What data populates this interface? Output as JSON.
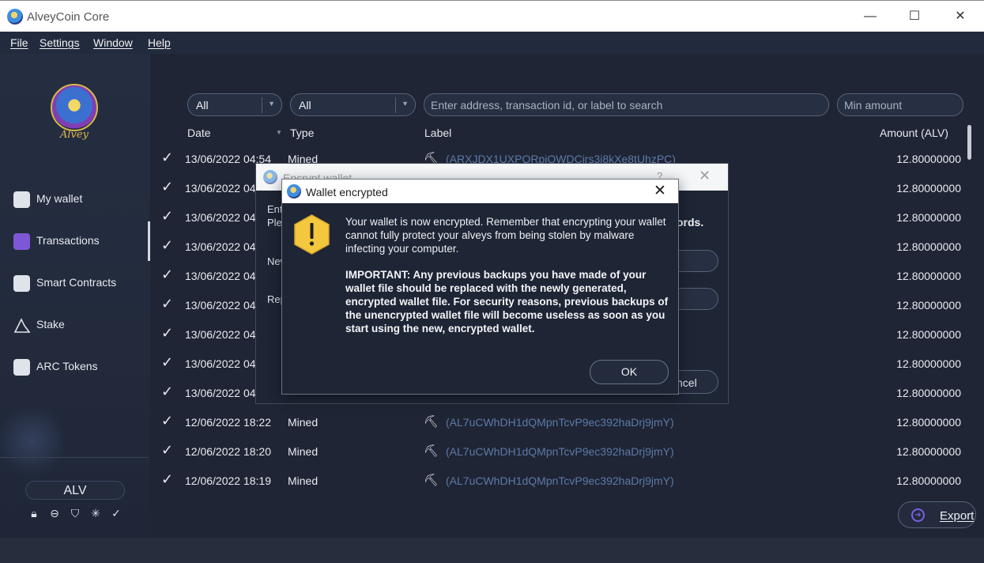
{
  "window": {
    "title": "AlveyCoin Core",
    "minimize_glyph": "—",
    "maximize_glyph": "☐",
    "close_glyph": "✕"
  },
  "menu": [
    "File",
    "Settings",
    "Window",
    "Help"
  ],
  "sidebar": {
    "avatar_caption": "Alvey",
    "items": [
      {
        "label": "My wallet",
        "icon": "wallet-icon"
      },
      {
        "label": "Transactions",
        "icon": "transactions-icon",
        "active": true
      },
      {
        "label": "Smart Contracts",
        "icon": "smart-contracts-icon"
      },
      {
        "label": "Stake",
        "icon": "stake-icon"
      },
      {
        "label": "ARC Tokens",
        "icon": "arc-tokens-icon"
      }
    ],
    "currency_unit": "ALV",
    "status_icons": [
      "lock-icon",
      "minus-circle-icon",
      "shield-icon",
      "network-icon",
      "check-icon"
    ]
  },
  "filters": {
    "date_filter": "All",
    "type_filter": "All",
    "search_placeholder": "Enter address, transaction id, or label to search",
    "min_amount_placeholder": "Min amount"
  },
  "table": {
    "headers": {
      "date": "Date",
      "type": "Type",
      "label": "Label",
      "amount": "Amount (ALV)"
    },
    "rows": [
      {
        "date": "13/06/2022 04:54",
        "type": "Mined",
        "label": "(ARXJDX1UXPQRpjQWDCjrs3j8kXe8tUhzPC)",
        "amount": "12.80000000"
      },
      {
        "date": "13/06/2022 04",
        "type": "",
        "label": "",
        "amount": "12.80000000"
      },
      {
        "date": "13/06/2022 04",
        "type": "",
        "label": "",
        "amount": "12.80000000"
      },
      {
        "date": "13/06/2022 04",
        "type": "",
        "label": "",
        "amount": "12.80000000"
      },
      {
        "date": "13/06/2022 04",
        "type": "",
        "label": "",
        "amount": "12.80000000"
      },
      {
        "date": "13/06/2022 04",
        "type": "",
        "label": "",
        "amount": "12.80000000"
      },
      {
        "date": "13/06/2022 04",
        "type": "",
        "label": "",
        "amount": "12.80000000"
      },
      {
        "date": "13/06/2022 04",
        "type": "",
        "label": "",
        "amount": "12.80000000"
      },
      {
        "date": "13/06/2022 04",
        "type": "",
        "label": "",
        "amount": "12.80000000"
      },
      {
        "date": "12/06/2022 18:22",
        "type": "Mined",
        "label": "(AL7uCWhDH1dQMpnTcvP9ec392haDrj9jmY)",
        "amount": "12.80000000"
      },
      {
        "date": "12/06/2022 18:20",
        "type": "Mined",
        "label": "(AL7uCWhDH1dQMpnTcvP9ec392haDrj9jmY)",
        "amount": "12.80000000"
      },
      {
        "date": "12/06/2022 18:19",
        "type": "Mined",
        "label": "(AL7uCWhDH1dQMpnTcvP9ec392haDrj9jmY)",
        "amount": "12.80000000"
      }
    ]
  },
  "export_button": "Export",
  "encrypt_dialog": {
    "title": "Encrypt wallet",
    "help_glyph": "?",
    "close_glyph": "✕",
    "line1": "Ent",
    "line2": "Plea",
    "line2_end": "ords.",
    "new_label": "New",
    "repeat_label": "Rep",
    "cancel_button": "ncel"
  },
  "wallet_encrypted_dialog": {
    "title": "Wallet encrypted",
    "close_glyph": "✕",
    "icon": "warning-icon",
    "message": "Your wallet is now encrypted. Remember that encrypting your wallet cannot fully protect your alveys from being stolen by malware infecting your computer.",
    "important": "IMPORTANT: Any previous backups you have made of your wallet file should be replaced with the newly generated, encrypted wallet file. For security reasons, previous backups of the unencrypted wallet file will become useless as soon as you start using the new, encrypted wallet.",
    "ok_button": "OK"
  },
  "colors": {
    "background": "#1f2534",
    "accent": "#7d58d6",
    "label_link": "#5d79a8",
    "warning": "#f3c73e"
  }
}
